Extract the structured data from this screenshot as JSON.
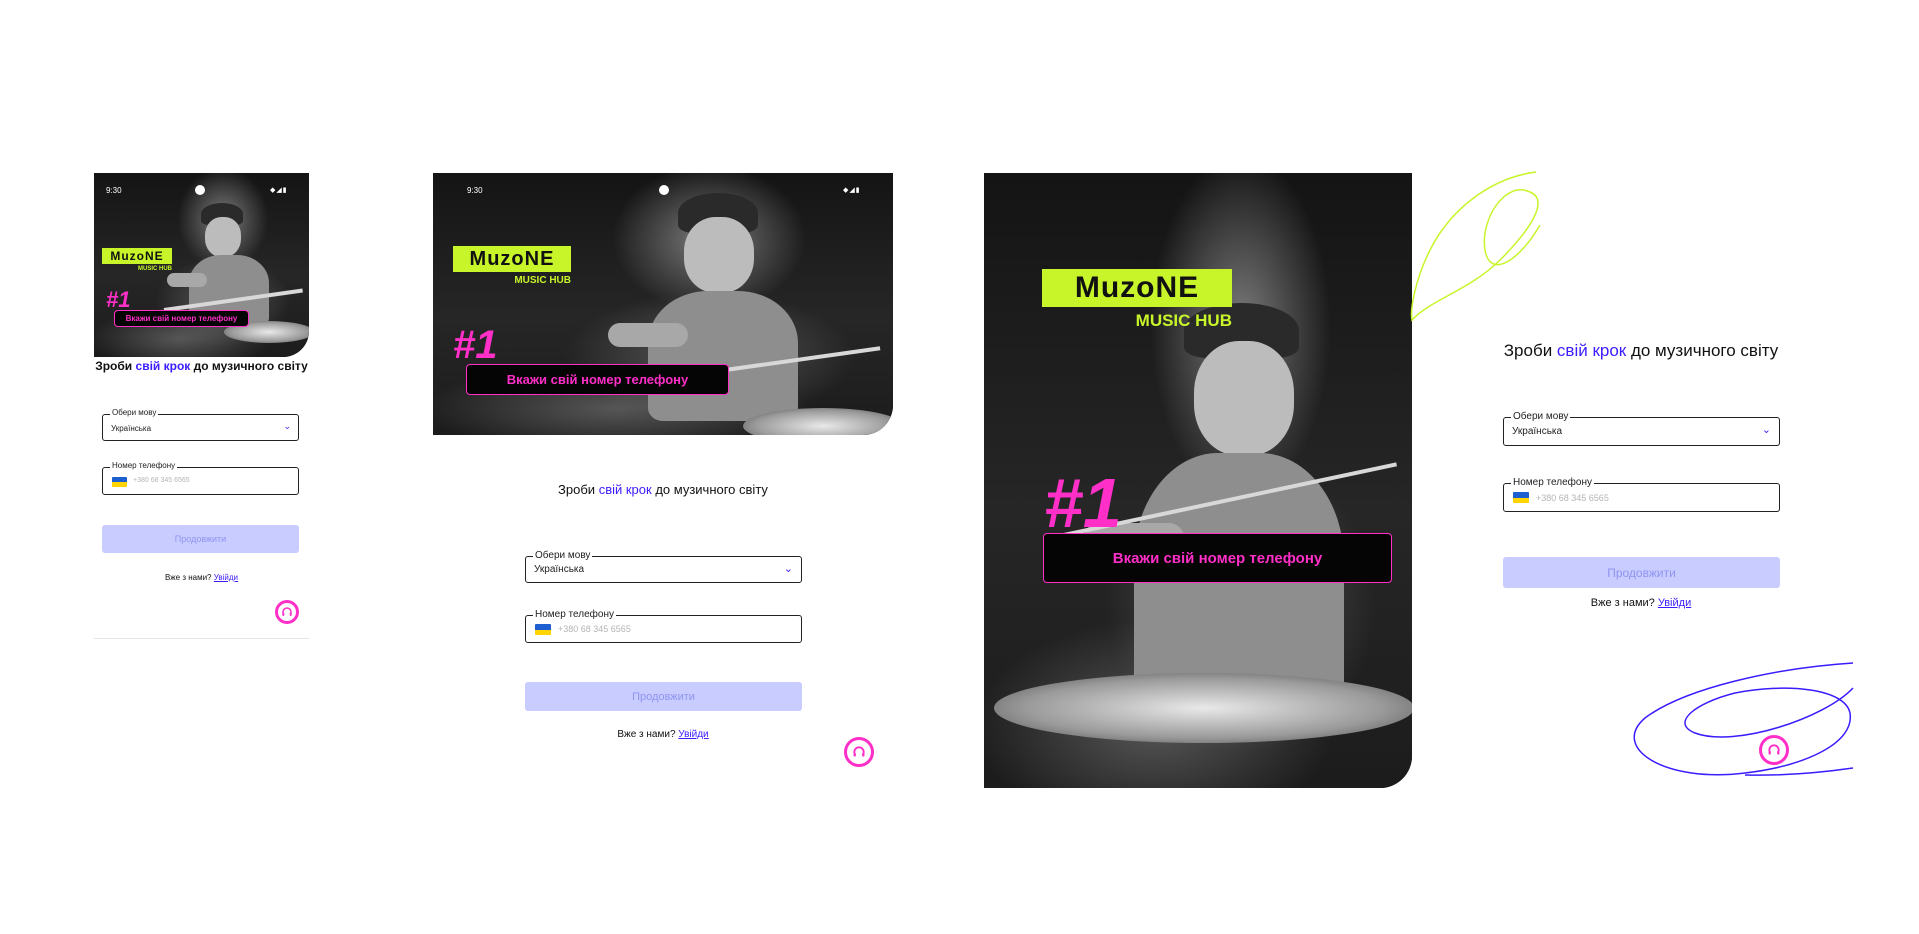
{
  "status": {
    "time": "9:30"
  },
  "logo": {
    "word": "MuzoNE",
    "sub": "MUSIC HUB"
  },
  "banner": {
    "number": "#1",
    "text": "Вкажи свій номер телефону"
  },
  "heading": {
    "pre": "Зроби ",
    "highlight": "свій крок",
    "post": " до музичного світу"
  },
  "language": {
    "label": "Обери мову",
    "value": "Українська"
  },
  "phone": {
    "label": "Номер телефону",
    "placeholder": "+380 68 345 6565"
  },
  "continue_label": "Продовжити",
  "login": {
    "question": "Вже з нами?",
    "link": "Увійди"
  },
  "colors": {
    "accent": "#3a1cff",
    "pink": "#ff2fc8",
    "lime": "#c7f52a",
    "button": "#c9ccff"
  },
  "icons": {
    "support": "headset-icon",
    "chevron": "chevron-down-icon",
    "flag": "ukraine-flag-icon"
  }
}
